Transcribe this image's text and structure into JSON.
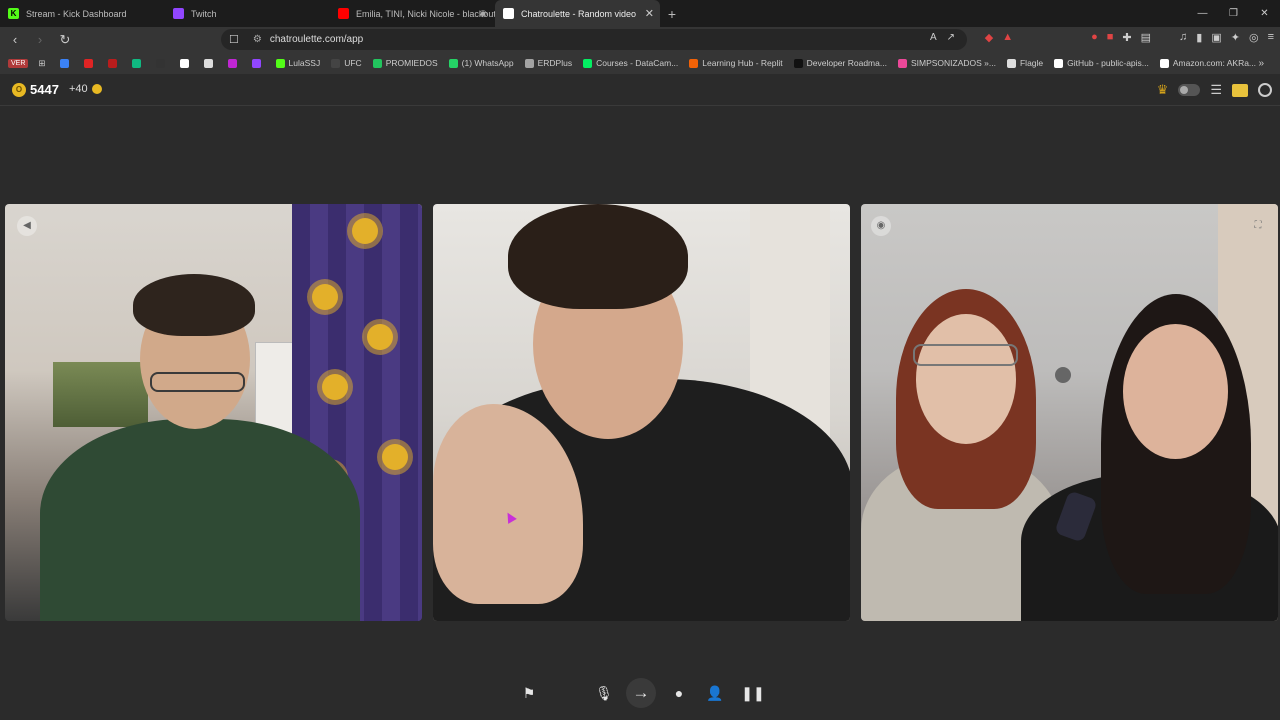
{
  "browser": {
    "tabs": [
      {
        "title": "Stream - Kick Dashboard",
        "color": "#53fc18",
        "glyph": "K"
      },
      {
        "title": "Twitch",
        "color": "#9146ff",
        "glyph": ""
      },
      {
        "title": "Emilia, TINI, Nicki Nicole - blackout",
        "color": "#ff0000",
        "glyph": ""
      },
      {
        "title": "Chatroulette - Random video",
        "color": "#ffffff",
        "glyph": ""
      }
    ],
    "url": "chatroulette.com/app",
    "bookmarks": [
      {
        "label": "",
        "color": "#3b82f6"
      },
      {
        "label": "",
        "color": "#e02424"
      },
      {
        "label": "",
        "color": "#b91c1c"
      },
      {
        "label": "",
        "color": "#10b981"
      },
      {
        "label": "",
        "color": "#333333"
      },
      {
        "label": "",
        "color": "#ffffff"
      },
      {
        "label": "",
        "color": "#dddddd"
      },
      {
        "label": "",
        "color": "#c026d3"
      },
      {
        "label": "",
        "color": "#9146ff"
      },
      {
        "label": "LulaSSJ",
        "color": "#53fc18"
      },
      {
        "label": "UFC",
        "color": "#444444"
      },
      {
        "label": "PROMIEDOS",
        "color": "#22c55e"
      },
      {
        "label": "(1) WhatsApp",
        "color": "#25d366"
      },
      {
        "label": "ERDPlus",
        "color": "#a3a3a3"
      },
      {
        "label": "Courses - DataCam...",
        "color": "#03ef62"
      },
      {
        "label": "Learning Hub - Replit",
        "color": "#f26207"
      },
      {
        "label": "Developer Roadma...",
        "color": "#111111"
      },
      {
        "label": "SIMPSONIZADOS »...",
        "color": "#ec4899"
      },
      {
        "label": "Flagle",
        "color": "#dddddd"
      },
      {
        "label": "GitHub - public-apis...",
        "color": "#ffffff"
      },
      {
        "label": "Amazon.com: AKRa...",
        "color": "#ffffff"
      }
    ],
    "ver_badge": "VER"
  },
  "app": {
    "points": "5447",
    "bonus": "+40"
  }
}
